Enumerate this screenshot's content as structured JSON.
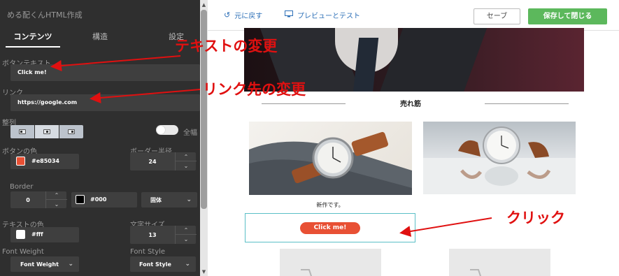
{
  "sidebar": {
    "title": "める配くんHTML作成",
    "tabs": [
      {
        "label": "コンテンツ",
        "active": true
      },
      {
        "label": "構造",
        "active": false
      },
      {
        "label": "設定",
        "active": false
      }
    ],
    "button_text_label": "ボタンテキスト",
    "button_text_value": "Click me!",
    "link_label": "リンク",
    "link_value": "https://google.com",
    "align_label": "整列",
    "full_width_label": "全幅",
    "button_color_label": "ボタンの色",
    "button_color_value": "#e85034",
    "border_radius_label": "ボーダー半径",
    "border_radius_value": "24",
    "border_label": "Border",
    "border_width_value": "0",
    "border_color_value": "#000",
    "border_style_value": "固体",
    "text_color_label": "テキストの色",
    "text_color_value": "#fff",
    "font_size_label": "文字サイズ",
    "font_size_value": "13",
    "font_weight_label": "Font Weight",
    "font_weight_value": "Font Weight",
    "font_style_label": "Font Style",
    "font_style_value": "Font Style"
  },
  "toolbar": {
    "undo_label": "元に戻す",
    "preview_label": "プレビューとテスト",
    "save_label": "セーブ",
    "save_close_label": "保存して閉じる"
  },
  "preview": {
    "section_title": "売れ筋",
    "product_caption": "新作です。",
    "button_label": "Click me!"
  },
  "annotations": {
    "text_change": "テキストの変更",
    "link_change": "リンク先の変更",
    "click": "クリック"
  },
  "colors": {
    "accent_blue": "#2c6fb7",
    "save_green": "#5cb85c",
    "cta_red": "#e85034",
    "annotation_red": "#e01010",
    "sidebar_bg": "#2f2f2f",
    "frame_teal": "#5bbfc7"
  },
  "icons": {
    "undo": "undo-icon",
    "preview": "monitor-icon"
  }
}
